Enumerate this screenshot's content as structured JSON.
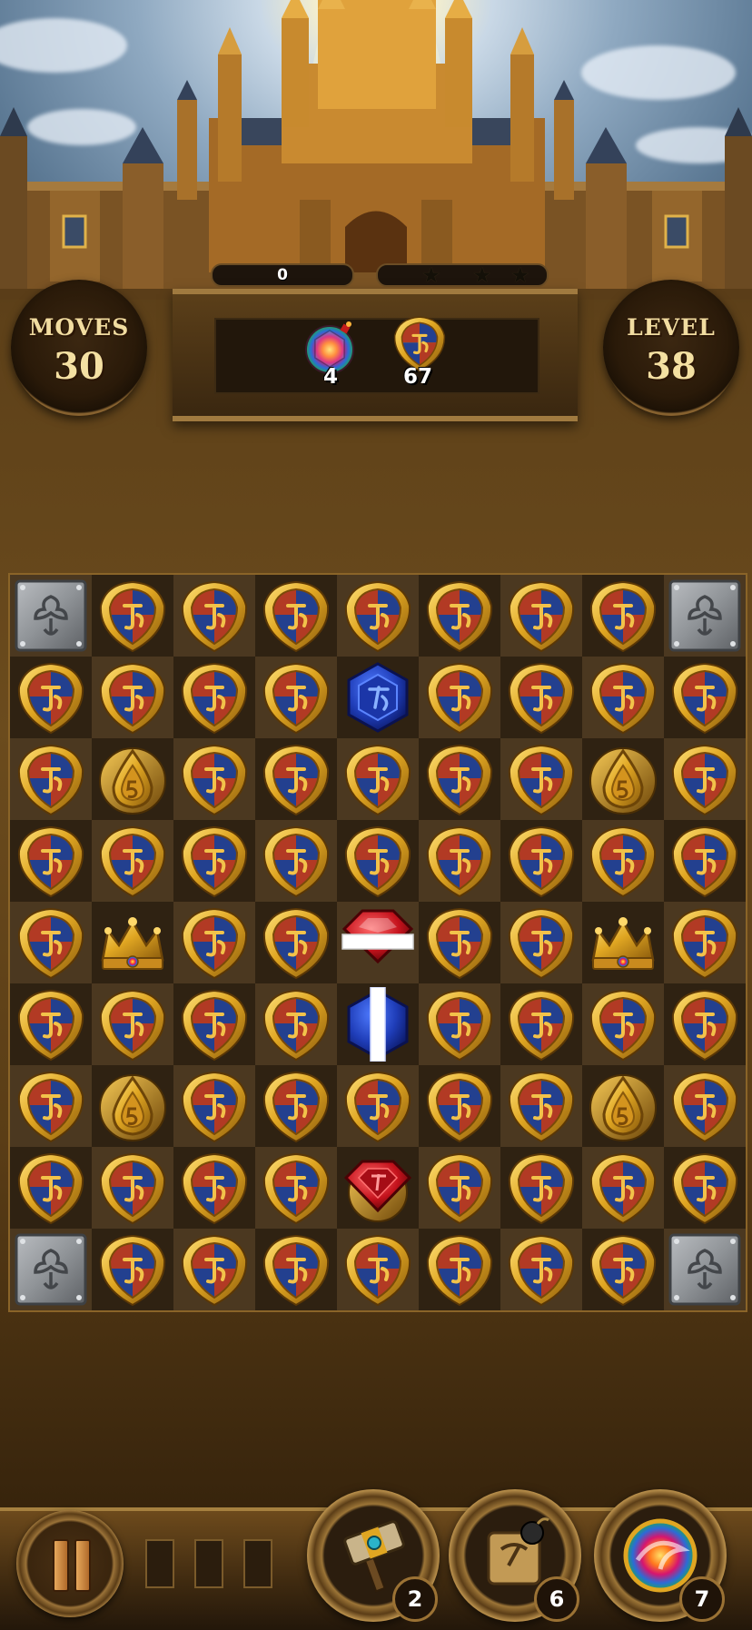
{
  "hud": {
    "moves_label": "MOVES",
    "moves_value": "30",
    "level_label": "LEVEL",
    "level_value": "38",
    "score": "0",
    "stars_earned": 0,
    "stars_total": 3
  },
  "goals": [
    {
      "icon": "rainbow-bomb-icon",
      "count": "4"
    },
    {
      "icon": "shield-tile-icon",
      "count": "67"
    }
  ],
  "board": {
    "rows": [
      [
        "S",
        "T",
        "T",
        "T",
        "T",
        "T",
        "T",
        "T",
        "S"
      ],
      [
        "T",
        "T",
        "T",
        "T",
        "H",
        "T",
        "T",
        "T",
        "T"
      ],
      [
        "T",
        "D",
        "T",
        "T",
        "T",
        "T",
        "T",
        "D",
        "T"
      ],
      [
        "T",
        "T",
        "T",
        "T",
        "T",
        "T",
        "T",
        "T",
        "T"
      ],
      [
        "T",
        "C",
        "T",
        "T",
        "R",
        "T",
        "T",
        "C",
        "T"
      ],
      [
        "T",
        "T",
        "T",
        "T",
        "B",
        "T",
        "T",
        "T",
        "T"
      ],
      [
        "T",
        "D",
        "T",
        "T",
        "T",
        "T",
        "T",
        "D",
        "T"
      ],
      [
        "T",
        "T",
        "T",
        "T",
        "G",
        "T",
        "T",
        "T",
        "T"
      ],
      [
        "S",
        "T",
        "T",
        "T",
        "T",
        "T",
        "T",
        "T",
        "S"
      ]
    ],
    "legend": {
      "S": "stone-block",
      "T": "shield-tile",
      "D": "golden-drop",
      "C": "crown",
      "H": "blue-hexagon-gem",
      "R": "red-striped-gem",
      "B": "blue-striped-gem",
      "G": "red-gem"
    }
  },
  "boosters": [
    {
      "icon": "hammer-icon",
      "count": "2"
    },
    {
      "icon": "bomb-crate-icon",
      "count": "6"
    },
    {
      "icon": "rainbow-orb-icon",
      "count": "7"
    }
  ],
  "colors": {
    "gold": "#e0a622",
    "shield_red": "#b23a24",
    "shield_blue": "#23408f"
  }
}
